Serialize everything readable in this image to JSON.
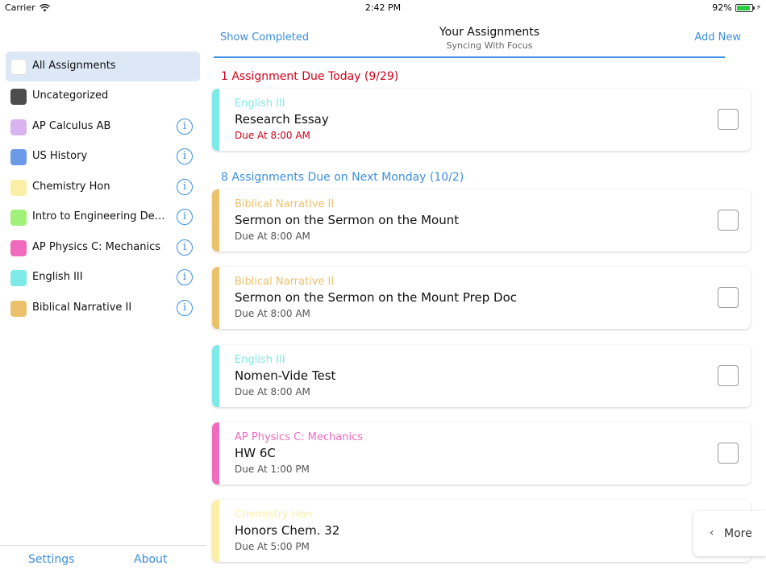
{
  "status_bar": {
    "carrier": "Carrier",
    "time": "2:42 PM",
    "battery": "92%",
    "battery_level": 0.92
  },
  "sidebar": {
    "items": [
      {
        "label": "All Assignments",
        "color": "#ffffff",
        "info": false,
        "selected": true
      },
      {
        "label": "Uncategorized",
        "color": "#4d4d4d",
        "info": false
      },
      {
        "label": "AP Calculus AB",
        "color": "#d9b3f0",
        "info": true
      },
      {
        "label": "US History",
        "color": "#6a9ae8",
        "info": true
      },
      {
        "label": "Chemistry Hon",
        "color": "#fbefa8",
        "info": true
      },
      {
        "label": "Intro to Engineering Design…",
        "color": "#a0f07a",
        "info": true
      },
      {
        "label": "AP Physics C: Mechanics",
        "color": "#f06bbd",
        "info": true
      },
      {
        "label": "English III",
        "color": "#7eeae8",
        "info": true
      },
      {
        "label": "Biblical Narrative II",
        "color": "#ecc16c",
        "info": true
      }
    ],
    "info_glyph": "i",
    "footer": {
      "settings": "Settings",
      "about": "About"
    }
  },
  "header": {
    "left": "Show Completed",
    "title": "Your Assignments",
    "subtitle": "Syncing With Focus",
    "right": "Add New"
  },
  "sections": [
    {
      "heading": "1 Assignment Due Today (9/29)",
      "color": "#d0021b"
    },
    {
      "heading": "8 Assignments Due on Next Monday (10/2)",
      "color": "#3d8fe0"
    }
  ],
  "cards": [
    {
      "course": "English III",
      "course_color": "#7eeae8",
      "title": "Research Essay",
      "due": "Due At 8:00 AM",
      "due_color": "#d0021b"
    },
    {
      "course": "Biblical Narrative II",
      "course_color": "#ecc16c",
      "title": "Sermon on the Sermon on the Mount",
      "due": "Due At 8:00 AM",
      "due_color": "#555555"
    },
    {
      "course": "Biblical Narrative II",
      "course_color": "#ecc16c",
      "title": "Sermon on the Sermon on the Mount Prep Doc",
      "due": "Due At 8:00 AM",
      "due_color": "#555555"
    },
    {
      "course": "English III",
      "course_color": "#7eeae8",
      "title": "Nomen-Vide Test",
      "due": "Due At 8:00 AM",
      "due_color": "#555555"
    },
    {
      "course": "AP Physics C: Mechanics",
      "course_color": "#f06bbd",
      "title": "HW 6C",
      "due": "Due At 1:00 PM",
      "due_color": "#555555"
    },
    {
      "course": "Chemistry Hon",
      "course_color": "#fbefa8",
      "title": "Honors Chem. 32",
      "due": "Due At 5:00 PM",
      "due_color": "#555555"
    }
  ],
  "more_button": {
    "label": "More",
    "glyph": "‹"
  }
}
